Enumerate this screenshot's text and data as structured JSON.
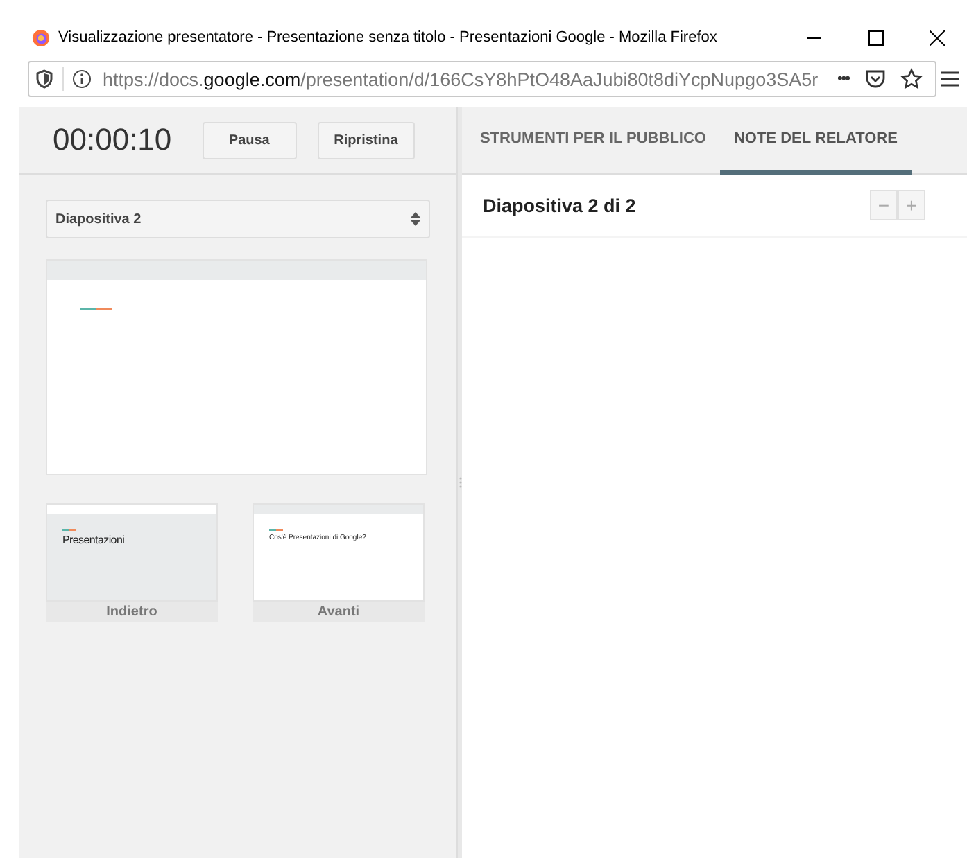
{
  "window": {
    "title": "Visualizzazione presentatore - Presentazione senza titolo - Presentazioni Google - Mozilla Firefox"
  },
  "address_bar": {
    "url_prefix": "https://docs.",
    "url_domain": "google.com",
    "url_path": "/presentation/d/166CsY8hPtO48AaJubi80t8diYcpNupgo3SA5r",
    "more": "•••"
  },
  "timer": {
    "time": "00:00:10",
    "buttons": [
      "Pausa",
      "Ripristina"
    ]
  },
  "slide_select": {
    "value": "Diapositiva 2"
  },
  "current_slide": {
    "kind": "content_slide"
  },
  "thumbnails": [
    {
      "kind": "title_slide",
      "title": "Presentazioni",
      "label": "Indietro"
    },
    {
      "kind": "content_slide",
      "title": "Cos'è Presentazioni di Google?",
      "label": "Avanti"
    }
  ],
  "tabs": [
    {
      "label": "STRUMENTI PER IL PUBBLICO",
      "selected": false
    },
    {
      "label": "NOTE DEL RELATORE",
      "selected": true
    }
  ],
  "notes": {
    "heading": "Diapositiva 2 di 2",
    "zoom_out": "−",
    "zoom_in": "+"
  }
}
